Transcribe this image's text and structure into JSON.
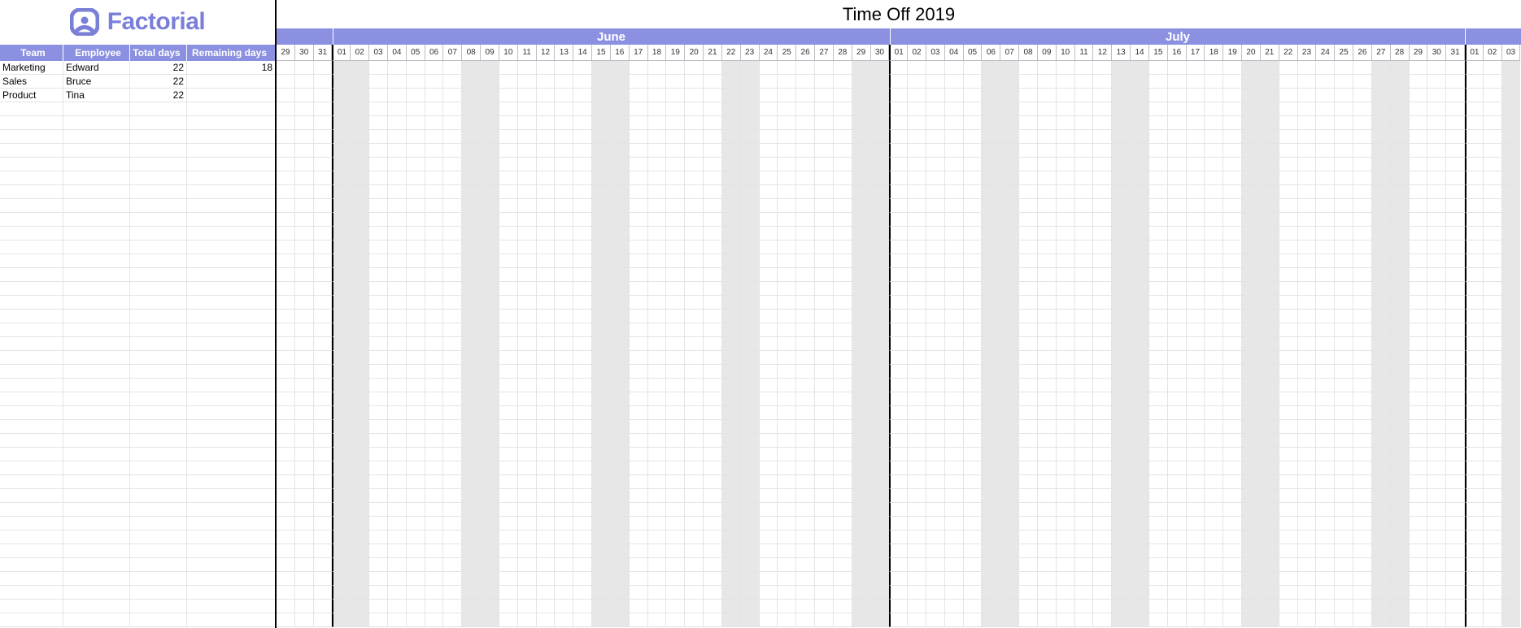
{
  "brand": {
    "name": "Factorial"
  },
  "title": "Time Off 2019",
  "left": {
    "headers": {
      "team": "Team",
      "employee": "Employee",
      "total_days": "Total days",
      "remaining_days": "Remaining days"
    },
    "rows": [
      {
        "team": "Marketing",
        "employee": "Edward",
        "total_days": "22",
        "remaining_days": "18"
      },
      {
        "team": "Sales",
        "employee": "Bruce",
        "total_days": "22",
        "remaining_days": ""
      },
      {
        "team": "Product",
        "employee": "Tina",
        "total_days": "22",
        "remaining_days": ""
      }
    ],
    "empty_rows": 38
  },
  "calendar": {
    "segments": [
      {
        "label": "",
        "days": [
          "29",
          "30",
          "31"
        ],
        "shaded_idx": []
      },
      {
        "label": "June",
        "days": [
          "01",
          "02",
          "03",
          "04",
          "05",
          "06",
          "07",
          "08",
          "09",
          "10",
          "11",
          "12",
          "13",
          "14",
          "15",
          "16",
          "17",
          "18",
          "19",
          "20",
          "21",
          "22",
          "23",
          "24",
          "25",
          "26",
          "27",
          "28",
          "29",
          "30"
        ],
        "shaded_idx": [
          0,
          1,
          7,
          8,
          14,
          15,
          21,
          22,
          28,
          29
        ]
      },
      {
        "label": "July",
        "days": [
          "01",
          "02",
          "03",
          "04",
          "05",
          "06",
          "07",
          "08",
          "09",
          "10",
          "11",
          "12",
          "13",
          "14",
          "15",
          "16",
          "17",
          "18",
          "19",
          "20",
          "21",
          "22",
          "23",
          "24",
          "25",
          "26",
          "27",
          "28",
          "29",
          "30",
          "31"
        ],
        "shaded_idx": [
          5,
          6,
          12,
          13,
          19,
          20,
          26,
          27
        ]
      },
      {
        "label": "",
        "days": [
          "01",
          "02",
          "03"
        ],
        "shaded_idx": [
          2
        ]
      }
    ]
  },
  "colors": {
    "accent": "#8b90e0",
    "shade": "#e7e7e7",
    "grid": "#e4e4e8"
  }
}
